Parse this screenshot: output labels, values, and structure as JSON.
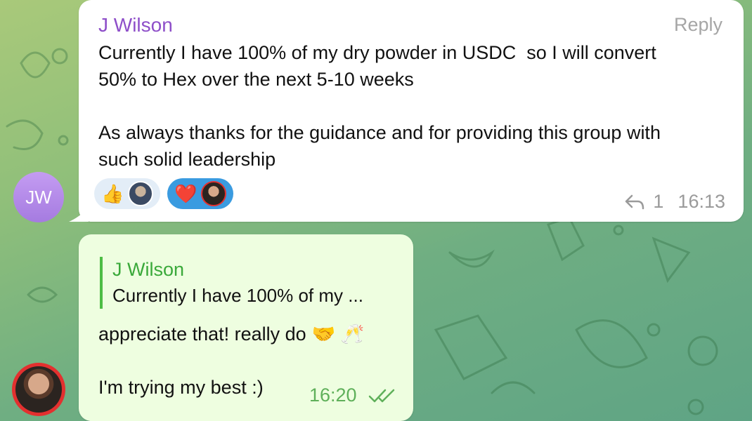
{
  "message_in": {
    "sender": "J Wilson",
    "reply_label": "Reply",
    "text": "Currently I have 100% of my dry powder in USDC  so I will convert\n50% to Hex over the next 5-10 weeks\n\nAs always thanks for the guidance and for providing this group with\nsuch solid leadership",
    "reactions": [
      {
        "emoji": "👍",
        "icon": "thumbs-up-icon"
      },
      {
        "emoji": "❤️",
        "icon": "heart-icon"
      }
    ],
    "reply_count": "1",
    "time": "16:13",
    "avatar_initials": "JW"
  },
  "message_out": {
    "quote_name": "J Wilson",
    "quote_text": "Currently I have 100% of my ...",
    "line1": "appreciate that! really do",
    "line1_emojis": "🤝 🥂",
    "line2": "I'm trying my best :)",
    "time": "16:20"
  },
  "colors": {
    "sender": "#8e4fc9",
    "outgoing_bubble": "#eefee0",
    "accent_green": "#4dbd45"
  }
}
